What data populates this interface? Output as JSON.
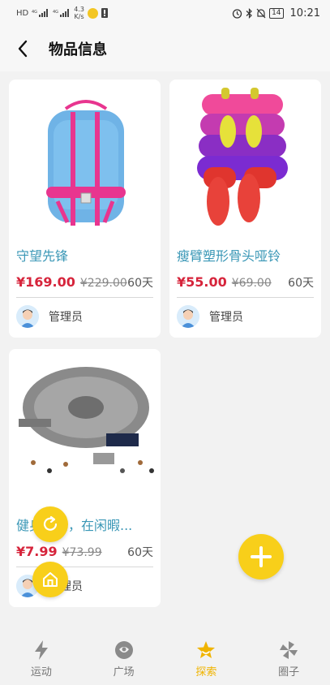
{
  "status_bar": {
    "left_indicators": [
      "HD",
      "4G",
      "4G"
    ],
    "net_speed_value": "4.3",
    "net_speed_unit": "K/s",
    "battery": "14",
    "time": "10:21"
  },
  "header": {
    "title": "物品信息"
  },
  "items": [
    {
      "name": "守望先锋",
      "price": "¥169.00",
      "old_price": "¥229.00",
      "days": "60天",
      "owner": "管理员"
    },
    {
      "name": "瘦臂塑形骨头哑铃",
      "price": "¥55.00",
      "old_price": "¥69.00",
      "days": "60天",
      "owner": "管理员"
    },
    {
      "name": "健身太累，在闲暇...",
      "price": "¥7.99",
      "old_price": "¥73.99",
      "days": "60天",
      "owner": "管理员"
    }
  ],
  "tabs": [
    {
      "label": "运动",
      "icon": "lightning-icon",
      "active": false
    },
    {
      "label": "广场",
      "icon": "square-icon",
      "active": false
    },
    {
      "label": "探索",
      "icon": "star-icon",
      "active": true
    },
    {
      "label": "圈子",
      "icon": "pinwheel-icon",
      "active": false
    }
  ],
  "colors": {
    "accent": "#f8cf1a",
    "item_name": "#3a97b6",
    "price": "#d6243b",
    "active_tab": "#f0b400"
  }
}
